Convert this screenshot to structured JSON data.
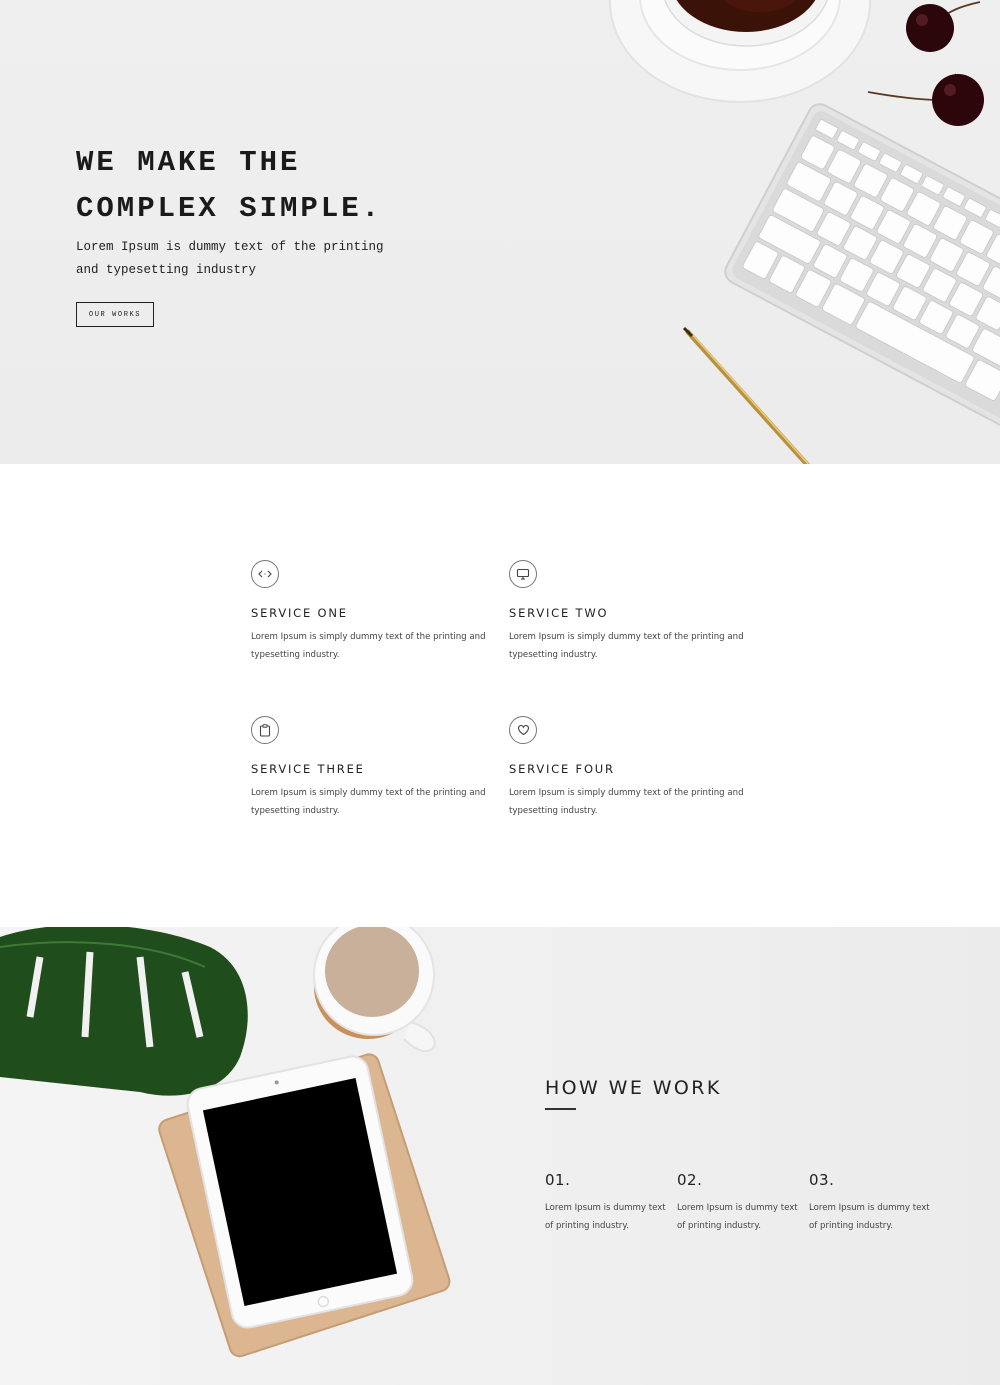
{
  "hero": {
    "title_line1": "WE MAKE THE",
    "title_line2": "COMPLEX SIMPLE.",
    "subtitle_line1": "Lorem Ipsum is dummy text of the printing",
    "subtitle_line2": "and typesetting industry",
    "button_label": "OUR WORKS",
    "image": "desk-keyboard-coffee-cherries-pen-photo"
  },
  "services": [
    {
      "icon": "code-icon",
      "title": "SERVICE ONE",
      "text_line1": "Lorem Ipsum is simply dummy text of the printing and",
      "text_line2": "typesetting industry."
    },
    {
      "icon": "monitor-icon",
      "title": "SERVICE TWO",
      "text_line1": "Lorem Ipsum is simply dummy text of the printing and",
      "text_line2": "typesetting industry."
    },
    {
      "icon": "clipboard-icon",
      "title": "SERVICE THREE",
      "text_line1": "Lorem Ipsum is simply dummy text of the printing and",
      "text_line2": "typesetting industry."
    },
    {
      "icon": "heart-icon",
      "title": "SERVICE FOUR",
      "text_line1": "Lorem Ipsum is simply dummy text of the printing and",
      "text_line2": "typesetting industry."
    }
  ],
  "how": {
    "title": "HOW WE WORK",
    "image": "monstera-leaf-coffee-tablet-notebook-photo",
    "steps": [
      {
        "number": "01.",
        "text_line1": "Lorem Ipsum is dummy text",
        "text_line2": "of printing industry."
      },
      {
        "number": "02.",
        "text_line1": "Lorem Ipsum is dummy text",
        "text_line2": "of printing industry."
      },
      {
        "number": "03.",
        "text_line1": "Lorem Ipsum is dummy text",
        "text_line2": "of printing industry."
      }
    ]
  },
  "colors": {
    "text": "#1a1a1a",
    "hero_bg": "#eeeeee",
    "section_bg": "#ffffff",
    "how_bg": "#efefef"
  }
}
